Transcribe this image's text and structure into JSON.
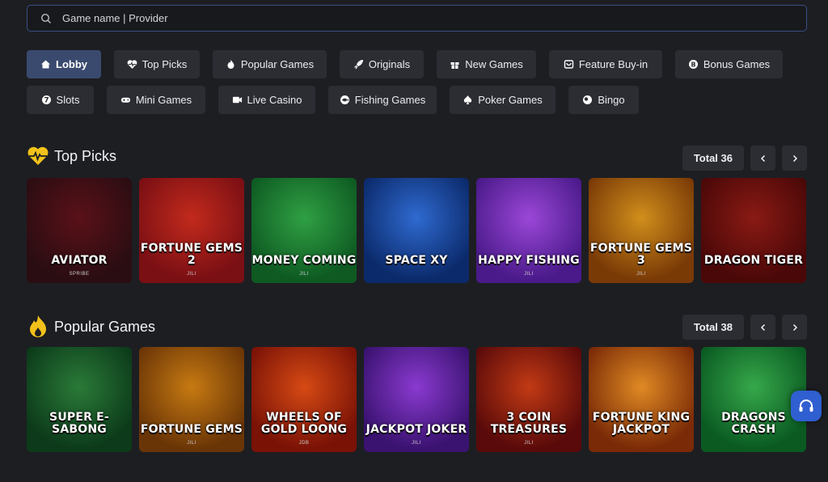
{
  "search": {
    "placeholder": "Game name | Provider"
  },
  "categories_row1": [
    {
      "label": "Lobby",
      "icon": "home-icon",
      "active": true
    },
    {
      "label": "Top Picks",
      "icon": "heart-pulse-icon"
    },
    {
      "label": "Popular Games",
      "icon": "flame-icon"
    },
    {
      "label": "Originals",
      "icon": "rocket-icon"
    },
    {
      "label": "New Games",
      "icon": "gift-icon"
    },
    {
      "label": "Feature Buy-in",
      "icon": "cart-icon"
    },
    {
      "label": "Bonus Games",
      "icon": "coin-icon"
    }
  ],
  "categories_row2": [
    {
      "label": "Slots",
      "icon": "seven-icon"
    },
    {
      "label": "Mini Games",
      "icon": "gamepad-icon"
    },
    {
      "label": "Live Casino",
      "icon": "video-icon"
    },
    {
      "label": "Fishing Games",
      "icon": "fish-icon"
    },
    {
      "label": "Poker Games",
      "icon": "spade-icon"
    },
    {
      "label": "Bingo",
      "icon": "ball-icon"
    }
  ],
  "top_picks": {
    "title": "Top Picks",
    "total": "Total 36",
    "games": [
      {
        "name": "AVIATOR",
        "provider": "SPRIBE",
        "c1": "#2a0d12",
        "c2": "#5a1118"
      },
      {
        "name": "FORTUNE GEMS 2",
        "provider": "JILI",
        "c1": "#7a0f14",
        "c2": "#c22a1c"
      },
      {
        "name": "MONEY COMING",
        "provider": "JILI",
        "c1": "#0e5a22",
        "c2": "#2fa043"
      },
      {
        "name": "SPACE XY",
        "provider": "",
        "c1": "#0b2a6b",
        "c2": "#2f6ad0"
      },
      {
        "name": "HAPPY FISHING",
        "provider": "JILI",
        "c1": "#4a1a8a",
        "c2": "#9b47d8"
      },
      {
        "name": "FORTUNE GEMS 3",
        "provider": "JILI",
        "c1": "#7a3a06",
        "c2": "#d18f1c"
      },
      {
        "name": "DRAGON TIGER",
        "provider": "",
        "c1": "#4a0808",
        "c2": "#8a1a14"
      }
    ]
  },
  "popular": {
    "title": "Popular Games",
    "total": "Total 38",
    "games": [
      {
        "name": "SUPER E-SABONG",
        "provider": "",
        "c1": "#0c3a1a",
        "c2": "#2a7a38"
      },
      {
        "name": "FORTUNE GEMS",
        "provider": "JILI",
        "c1": "#6a3506",
        "c2": "#c77a12"
      },
      {
        "name": "WHEELS OF GOLD LOONG",
        "provider": "JDB",
        "c1": "#7a1206",
        "c2": "#d64a14"
      },
      {
        "name": "JACKPOT JOKER",
        "provider": "JILI",
        "c1": "#3a1270",
        "c2": "#8a3ad0"
      },
      {
        "name": "3 COIN TREASURES",
        "provider": "JILI",
        "c1": "#5a0a0a",
        "c2": "#c23a14"
      },
      {
        "name": "FORTUNE KING JACKPOT",
        "provider": "",
        "c1": "#7a2a06",
        "c2": "#e08a24"
      },
      {
        "name": "DRAGONS CRASH",
        "provider": "",
        "c1": "#0a5a22",
        "c2": "#36a84a"
      }
    ]
  },
  "colors": {
    "accent": "#3a4f86",
    "chip": "#2c2d33",
    "bg": "#1d1e22",
    "icon_yellow": "#f2c21a"
  }
}
